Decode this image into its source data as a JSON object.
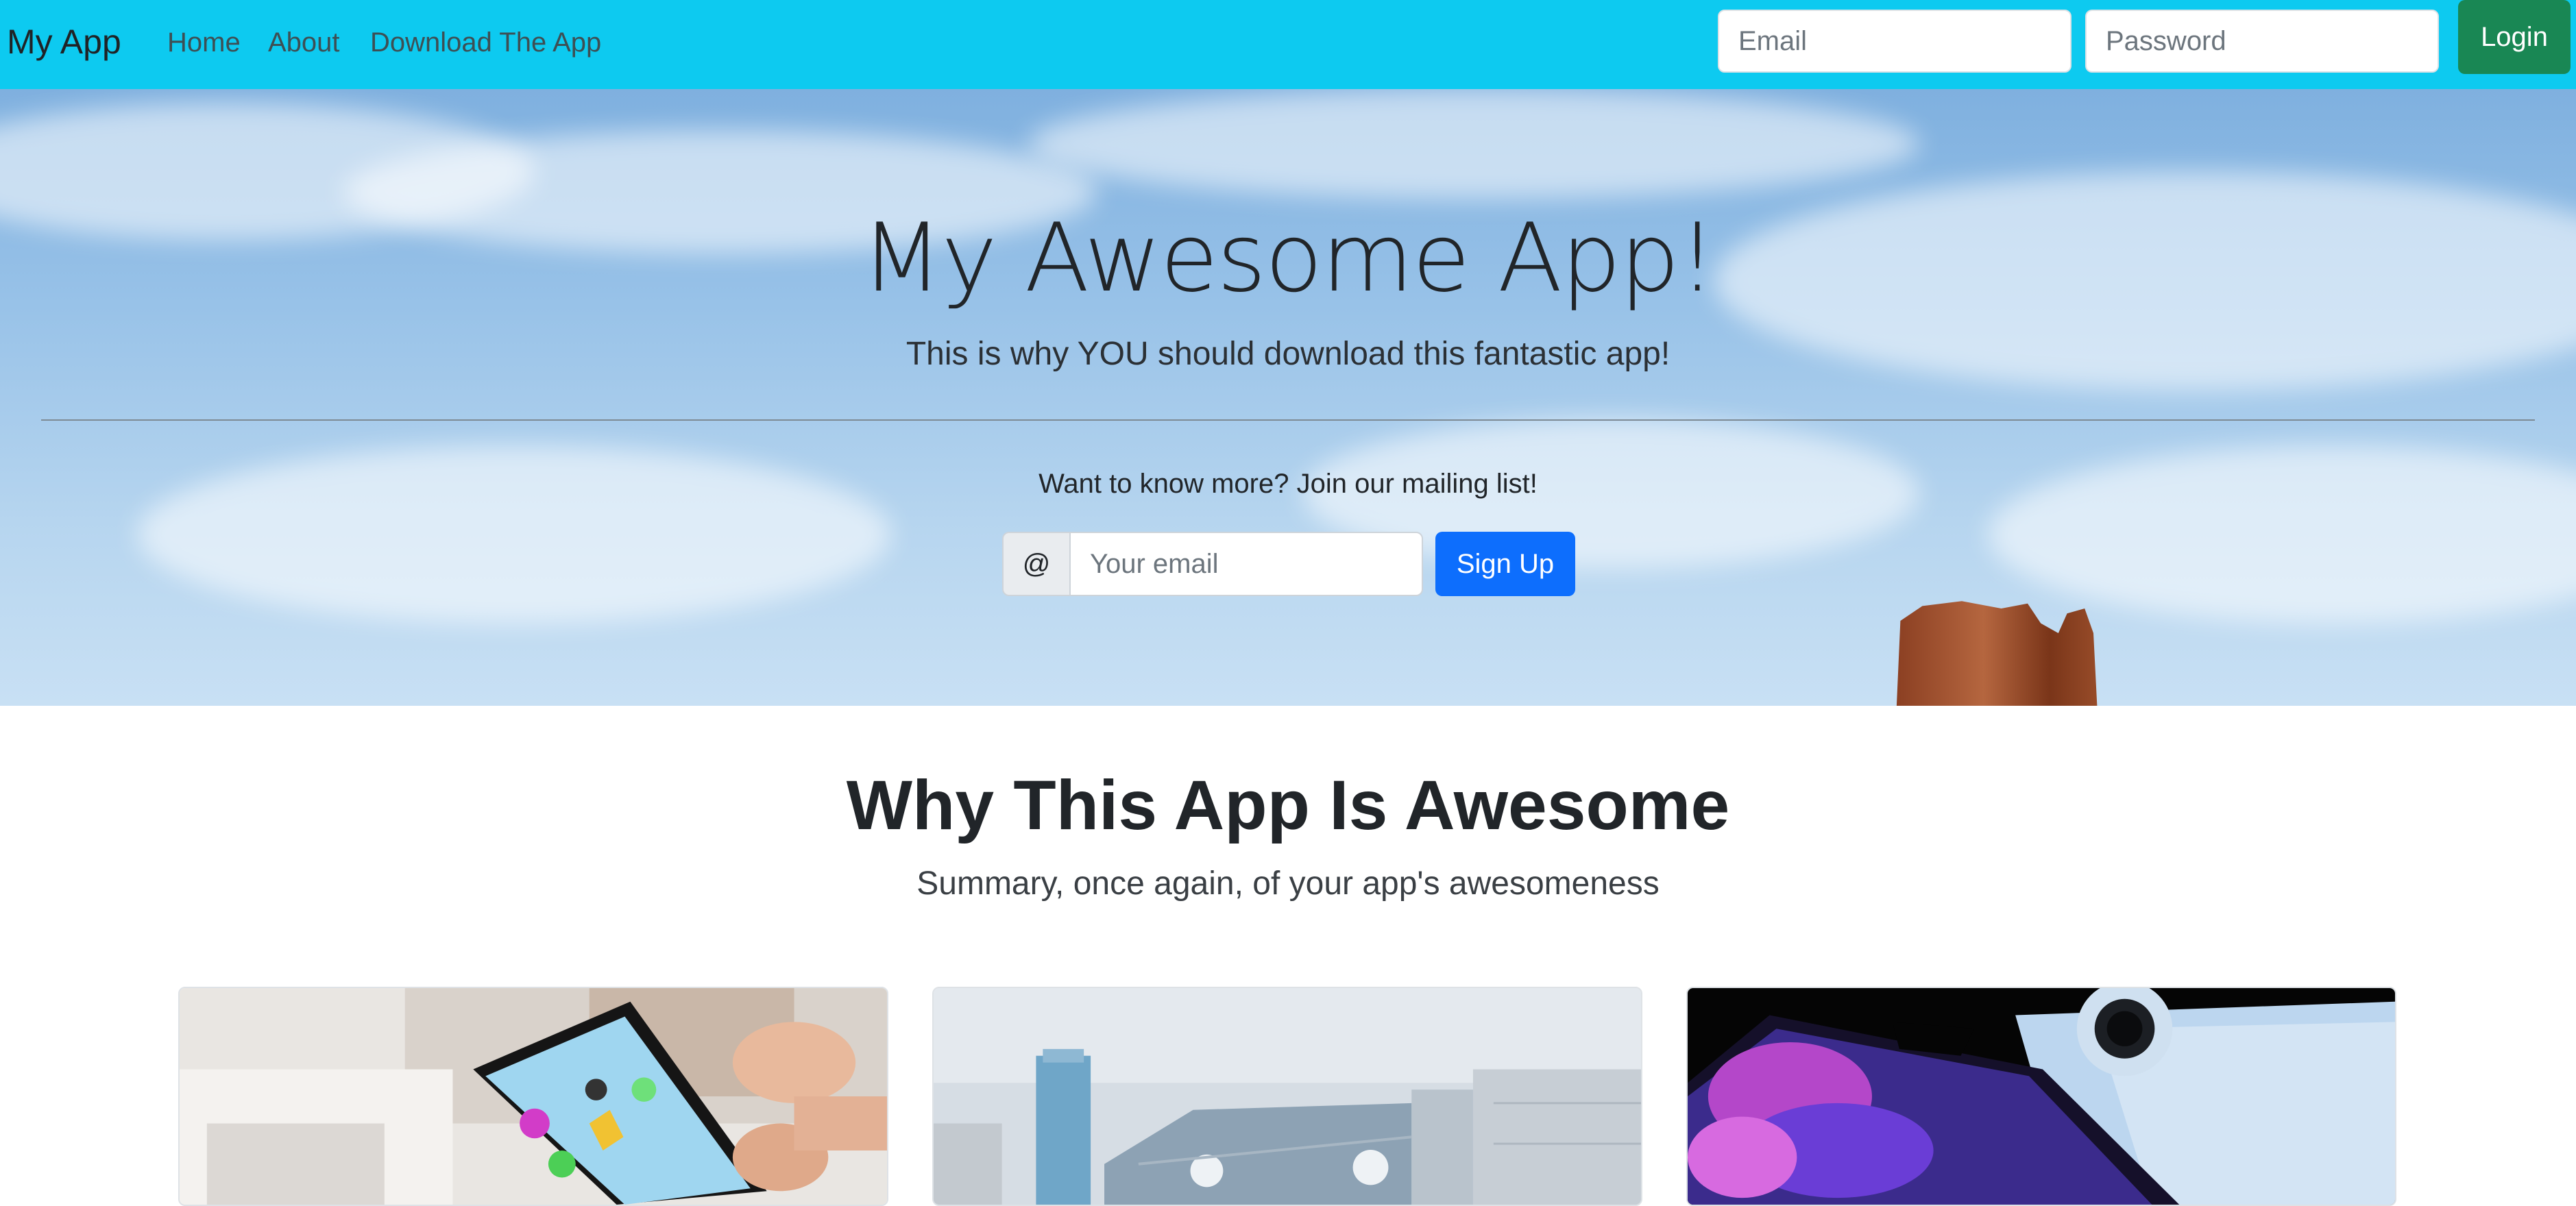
{
  "navbar": {
    "brand": "My App",
    "links": [
      {
        "label": "Home"
      },
      {
        "label": "About"
      },
      {
        "label": "Download The App"
      }
    ],
    "email_placeholder": "Email",
    "password_placeholder": "Password",
    "login_label": "Login"
  },
  "hero": {
    "title": "My Awesome App!",
    "subtitle": "This is why YOU should download this fantastic app!",
    "mailing_text": "Want to know more? Join our mailing list!",
    "at_symbol": "@",
    "email_placeholder": "Your email",
    "signup_label": "Sign Up"
  },
  "features": {
    "title": "Why This App Is Awesome",
    "subtitle": "Summary, once again, of your app's awesomeness"
  },
  "colors": {
    "navbar_bg": "#0dcaf0",
    "login_btn": "#198754",
    "signup_btn": "#0d6efd"
  }
}
